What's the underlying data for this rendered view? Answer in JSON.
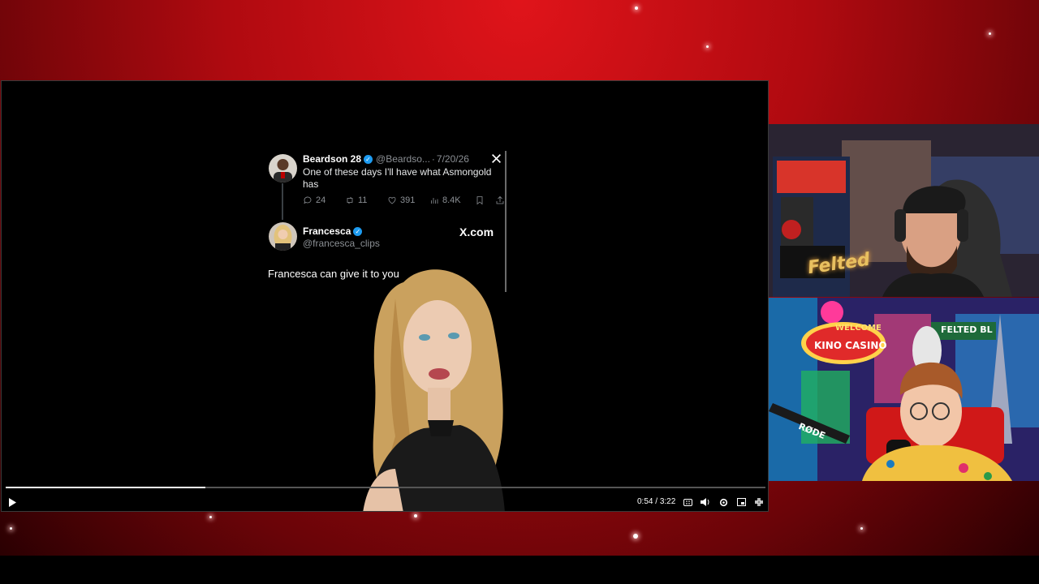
{
  "tweet": {
    "author_name": "Beardson 28",
    "author_handle": "@Beardso...",
    "separator": "·",
    "date": "7/20/26",
    "text_line1": "One of these days I'll have what Asmongold",
    "text_line2": "has",
    "metrics": {
      "replies": "24",
      "retweets": "11",
      "likes": "391",
      "views": "8.4K"
    }
  },
  "reply": {
    "author_name": "Francesca",
    "author_handle": "@francesca_clips",
    "source_label": "X.com"
  },
  "caption": "Francesca can give it to you",
  "player": {
    "time_current": "0:54",
    "time_total": "3:22",
    "time_sep": " / ",
    "progress": 0.263
  },
  "cam1": {
    "sign_text": "Felted"
  },
  "cam2": {
    "welcome_text": "WELCOME",
    "casino_text": "KINO CASINO",
    "street_sign": "FELTED BL",
    "mic_brand": "RØDE"
  },
  "colors": {
    "verified": "#1d9bf0",
    "stage_red": "#c8101a"
  },
  "icons": [
    "x-logo-icon",
    "reply-icon",
    "retweet-icon",
    "like-icon",
    "views-icon",
    "bookmark-icon",
    "share-icon",
    "play-icon",
    "captions-icon",
    "volume-icon",
    "settings-icon",
    "miniplayer-icon",
    "fullscreen-exit-icon"
  ]
}
